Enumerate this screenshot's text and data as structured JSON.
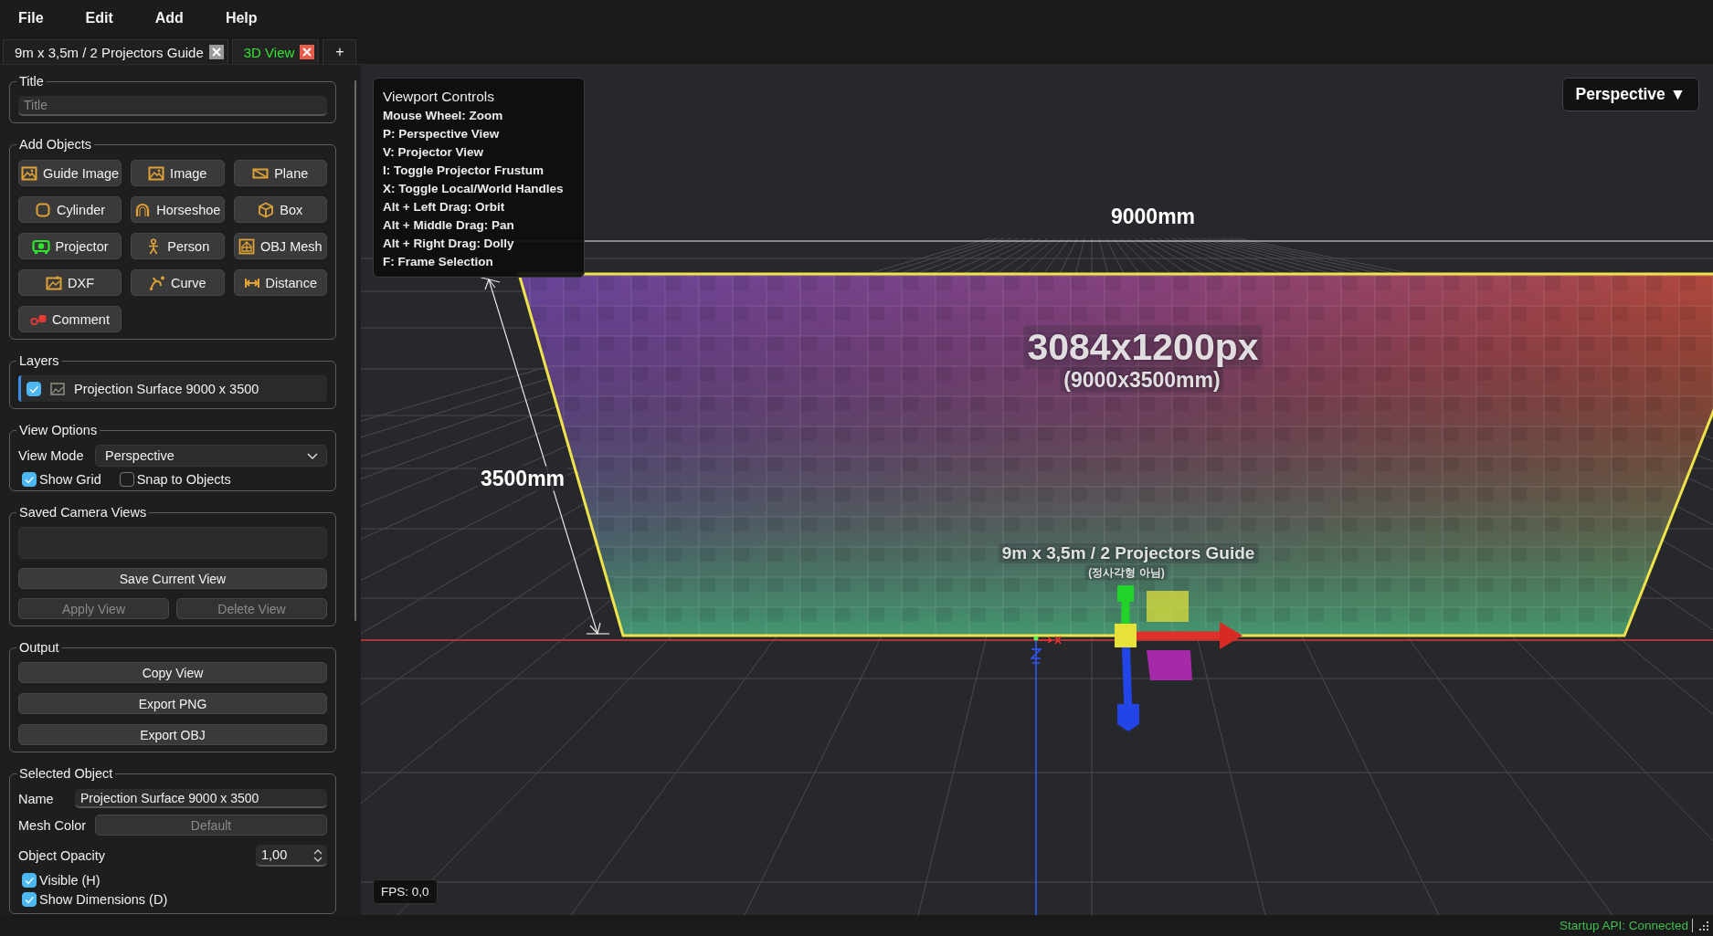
{
  "menu": [
    {
      "label": "File"
    },
    {
      "label": "Edit"
    },
    {
      "label": "Add"
    },
    {
      "label": "Help"
    }
  ],
  "tabs": [
    {
      "label": "9m x 3,5m / 2 Projectors Guide",
      "selected": false
    },
    {
      "label": "3D View",
      "selected": true
    }
  ],
  "new_tab": "+",
  "title_group": {
    "legend": "Title",
    "placeholder": "Title"
  },
  "add_objects": {
    "legend": "Add Objects",
    "buttons": [
      {
        "label": "Guide Image",
        "kind": "guide-image"
      },
      {
        "label": "Image",
        "kind": "image"
      },
      {
        "label": "Plane",
        "kind": "plane"
      },
      {
        "label": "Cylinder",
        "kind": "cylinder"
      },
      {
        "label": "Horseshoe",
        "kind": "horseshoe"
      },
      {
        "label": "Box",
        "kind": "box"
      },
      {
        "label": "Projector",
        "kind": "projector"
      },
      {
        "label": "Person",
        "kind": "person"
      },
      {
        "label": "OBJ Mesh",
        "kind": "mesh"
      },
      {
        "label": "DXF",
        "kind": "dxf"
      },
      {
        "label": "Curve",
        "kind": "curve"
      },
      {
        "label": "Distance",
        "kind": "distance"
      },
      {
        "label": "Comment",
        "kind": "comment"
      }
    ]
  },
  "layers": {
    "legend": "Layers",
    "items": [
      {
        "name": "Projection Surface 9000 x 3500",
        "checked": true,
        "selected": true
      }
    ]
  },
  "view_options": {
    "legend": "View Options",
    "view_mode_label": "View Mode",
    "view_mode": "Perspective",
    "checks": [
      {
        "label": "Show Grid",
        "checked": true
      },
      {
        "label": "Snap to Objects",
        "checked": false
      }
    ]
  },
  "saved_views": {
    "legend": "Saved Camera Views",
    "buttons": [
      {
        "label": "Save Current View",
        "disabled": false
      },
      {
        "label": "Apply View",
        "disabled": true
      },
      {
        "label": "Delete View",
        "disabled": true
      }
    ]
  },
  "output": {
    "legend": "Output",
    "buttons": [
      {
        "label": "Copy View"
      },
      {
        "label": "Export PNG"
      },
      {
        "label": "Export OBJ"
      }
    ]
  },
  "selected_object": {
    "legend": "Selected Object",
    "name_label": "Name",
    "name": "Projection Surface 9000 x 3500",
    "mesh_color_label": "Mesh Color",
    "mesh_color": "Default",
    "mesh_color_disabled": true,
    "opacity_label": "Object Opacity",
    "opacity": "1,00",
    "checks": [
      {
        "label": "Visible (H)",
        "checked": true
      },
      {
        "label": "Show Dimensions (D)",
        "checked": true
      }
    ]
  },
  "viewport": {
    "controls_title": "Viewport Controls",
    "controls": [
      "Mouse Wheel: Zoom",
      "P: Perspective View",
      "V: Projector View",
      "I: Toggle Projector Frustum",
      "X: Toggle Local/World Handles",
      "Alt + Left Drag: Orbit",
      "Alt + Middle Drag: Pan",
      "Alt + Right Drag: Dolly",
      "F: Frame Selection"
    ],
    "camera_mode": "Perspective",
    "camera_caret": "▼",
    "fps": "FPS: 0,0",
    "width_dimension": "9000mm",
    "height_dimension": "3500mm",
    "resolution_label": "3084x1200px",
    "size_label": "(9000x3500mm)",
    "guide_title": "9m x 3,5m / 2 Projectors Guide",
    "guide_note": "(정사각형 아님)"
  },
  "status_bar": {
    "api_status": "Startup API: Connected"
  }
}
